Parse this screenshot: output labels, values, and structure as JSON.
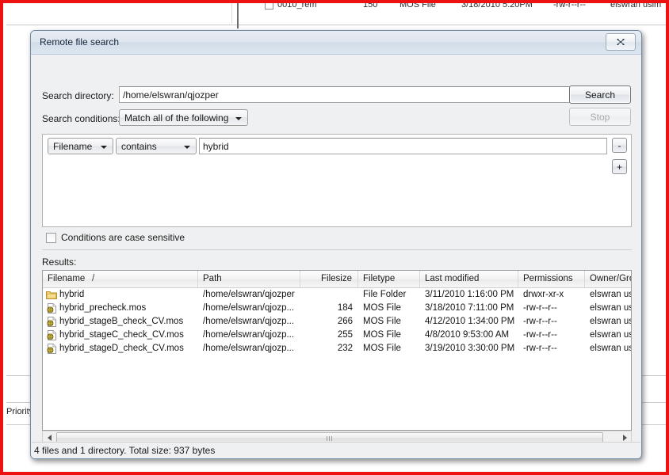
{
  "background": {
    "clipped_row": {
      "filename": "0010_rem",
      "filesize": "150",
      "filetype": "MOS File",
      "modified": "3/18/2010 5:20PM",
      "permissions": "-rw-r--r--",
      "owner": "elswran uslm"
    },
    "priority_column_header": "Priority"
  },
  "dialog": {
    "title": "Remote file search",
    "close_label": "close-window",
    "fields": {
      "search_directory_label": "Search directory:",
      "search_directory_value": "/home/elswran/qjozper",
      "search_conditions_label": "Search conditions:",
      "search_conditions_value": "Match all of the following"
    },
    "buttons": {
      "search": "Search",
      "stop": "Stop",
      "remove_condition": "-",
      "add_condition": "+"
    },
    "condition_row": {
      "field": "Filename",
      "operator": "contains",
      "value": "hybrid"
    },
    "case_sensitive": {
      "label": "Conditions are case sensitive",
      "checked": false
    },
    "results_label": "Results:",
    "columns": [
      {
        "label": "Filename",
        "sort": "/",
        "align": "left"
      },
      {
        "label": "Path",
        "align": "left"
      },
      {
        "label": "Filesize",
        "align": "right"
      },
      {
        "label": "Filetype",
        "align": "left"
      },
      {
        "label": "Last modified",
        "align": "left"
      },
      {
        "label": "Permissions",
        "align": "left"
      },
      {
        "label": "Owner/Gro",
        "align": "left"
      }
    ],
    "rows": [
      {
        "icon": "folder-icon",
        "filename": "hybrid",
        "path": "/home/elswran/qjozper",
        "filesize": "",
        "filetype": "File Folder",
        "modified": "3/11/2010 1:16:00 PM",
        "permissions": "drwxr-xr-x",
        "owner": "elswran us"
      },
      {
        "icon": "mos-file-icon",
        "filename": "hybrid_precheck.mos",
        "path": "/home/elswran/qjozp...",
        "filesize": "184",
        "filetype": "MOS File",
        "modified": "3/18/2010 7:11:00 PM",
        "permissions": "-rw-r--r--",
        "owner": "elswran us"
      },
      {
        "icon": "mos-file-icon",
        "filename": "hybrid_stageB_check_CV.mos",
        "path": "/home/elswran/qjozp...",
        "filesize": "266",
        "filetype": "MOS File",
        "modified": "4/12/2010 1:34:00 PM",
        "permissions": "-rw-r--r--",
        "owner": "elswran us"
      },
      {
        "icon": "mos-file-icon",
        "filename": "hybrid_stageC_check_CV.mos",
        "path": "/home/elswran/qjozp...",
        "filesize": "255",
        "filetype": "MOS File",
        "modified": "4/8/2010 9:53:00 AM",
        "permissions": "-rw-r--r--",
        "owner": "elswran us"
      },
      {
        "icon": "mos-file-icon",
        "filename": "hybrid_stageD_check_CV.mos",
        "path": "/home/elswran/qjozp...",
        "filesize": "232",
        "filetype": "MOS File",
        "modified": "3/19/2010 3:30:00 PM",
        "permissions": "-rw-r--r--",
        "owner": "elswran us"
      }
    ],
    "status": "4 files and 1 directory. Total size: 937 bytes"
  },
  "colors": {
    "frame_red": "#ee1111",
    "dialog_bg": "#eff0f1",
    "titlebar_border": "#b6c4d4",
    "folder_icon": "#e8c15a"
  }
}
